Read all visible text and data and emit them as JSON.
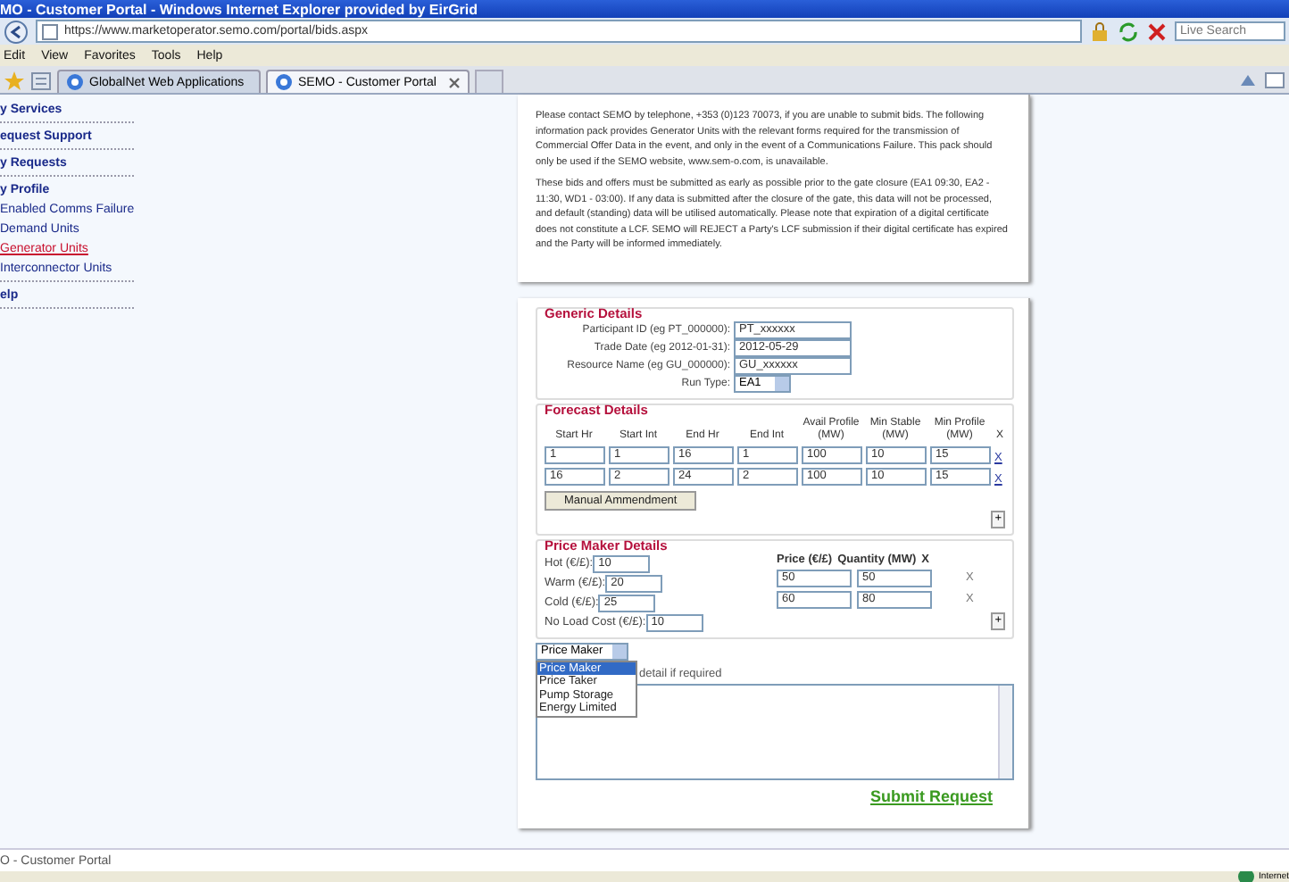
{
  "window": {
    "title": "MO - Customer Portal - Windows Internet Explorer provided by EirGrid"
  },
  "address_bar": {
    "url": "https://www.marketoperator.semo.com/portal/bids.aspx",
    "search_placeholder": "Live Search"
  },
  "menu": [
    "Edit",
    "View",
    "Favorites",
    "Tools",
    "Help"
  ],
  "tabs": [
    {
      "label": "GlobalNet Web Applications",
      "selected": false
    },
    {
      "label": "SEMO - Customer Portal",
      "selected": true
    }
  ],
  "sidebar": {
    "items": [
      {
        "label": "y Services",
        "selected": false
      },
      {
        "label": "equest Support",
        "selected": false
      },
      {
        "label": "y Requests",
        "selected": false
      },
      {
        "label": "y Profile",
        "selected": false,
        "children": [
          {
            "label": "Enabled Comms Failure",
            "selected": false
          },
          {
            "label": "Demand Units",
            "selected": false
          },
          {
            "label": "Generator Units",
            "selected": true
          },
          {
            "label": "Interconnector Units",
            "selected": false
          }
        ]
      },
      {
        "label": "elp",
        "selected": false
      }
    ]
  },
  "notice": [
    "Please contact SEMO by telephone, +353 (0)123 70073, if you are unable to submit bids. The following information pack provides Generator Units with the relevant forms required for the transmission of Commercial Offer Data in the event, and only in the event of a Communications Failure. This pack should only be used if the SEMO website, www.sem-o.com, is unavailable.",
    "These bids and offers must be submitted as early as possible prior to the gate closure (EA1 09:30, EA2 - 11:30, WD1 - 03:00). If any data is submitted after the closure of the gate, this data will not be processed, and default (standing) data will be utilised automatically. Please note that expiration of a digital certificate does not constitute a LCF. SEMO will REJECT a Party's LCF submission if their digital certificate has expired and the Party will be informed immediately."
  ],
  "generic_details": {
    "title": "Generic Details",
    "fields": [
      {
        "label": "Participant ID (eg PT_000000):",
        "value": "PT_xxxxxx",
        "kind": "text"
      },
      {
        "label": "Trade Date (eg 2012-01-31):",
        "value": "2012-05-29",
        "kind": "text"
      },
      {
        "label": "Resource Name (eg GU_000000):",
        "value": "GU_xxxxxx",
        "kind": "text"
      },
      {
        "label": "Run Type:",
        "value": "EA1",
        "kind": "select"
      }
    ]
  },
  "forecast_details": {
    "title": "Forecast Details",
    "columns": [
      "Start Hr",
      "Start Int",
      "End Hr",
      "End Int",
      "Avail Profile (MW)",
      "Min Stable (MW)",
      "Min Profile (MW)",
      "X"
    ],
    "rows": [
      {
        "cells": [
          "1",
          "1",
          "16",
          "1",
          "100",
          "10",
          "15"
        ],
        "remove": "X"
      },
      {
        "cells": [
          "16",
          "2",
          "24",
          "2",
          "100",
          "10",
          "15"
        ],
        "remove": "X"
      }
    ],
    "button": "Manual Ammendment",
    "add": "+"
  },
  "price_maker_details": {
    "title": "Price Maker Details",
    "fields": [
      {
        "label": "Hot (€/£):",
        "value": "10"
      },
      {
        "label": "Warm (€/£):",
        "value": "20"
      },
      {
        "label": "Cold (€/£):",
        "value": "25"
      },
      {
        "label": "No Load Cost (€/£):",
        "value": "10"
      }
    ],
    "columns": [
      "Price (€/£)",
      "Quantity (MW)",
      "X"
    ],
    "rows": [
      {
        "cells": [
          "50",
          "50"
        ],
        "remove": "X"
      },
      {
        "cells": [
          "60",
          "80"
        ],
        "remove": "X"
      }
    ],
    "add": "+"
  },
  "unit_type": {
    "value": "Price Maker",
    "options": [
      {
        "label": "Price Maker",
        "selected": true
      },
      {
        "label": "Price Taker",
        "selected": false
      },
      {
        "label": "Pump Storage",
        "selected": false
      },
      {
        "label": "Energy Limited",
        "selected": false
      }
    ]
  },
  "detail_label": "detail if required",
  "submit": "Submit Request",
  "status_bar": {
    "text": "O - Customer Portal",
    "zone": "Internet"
  }
}
